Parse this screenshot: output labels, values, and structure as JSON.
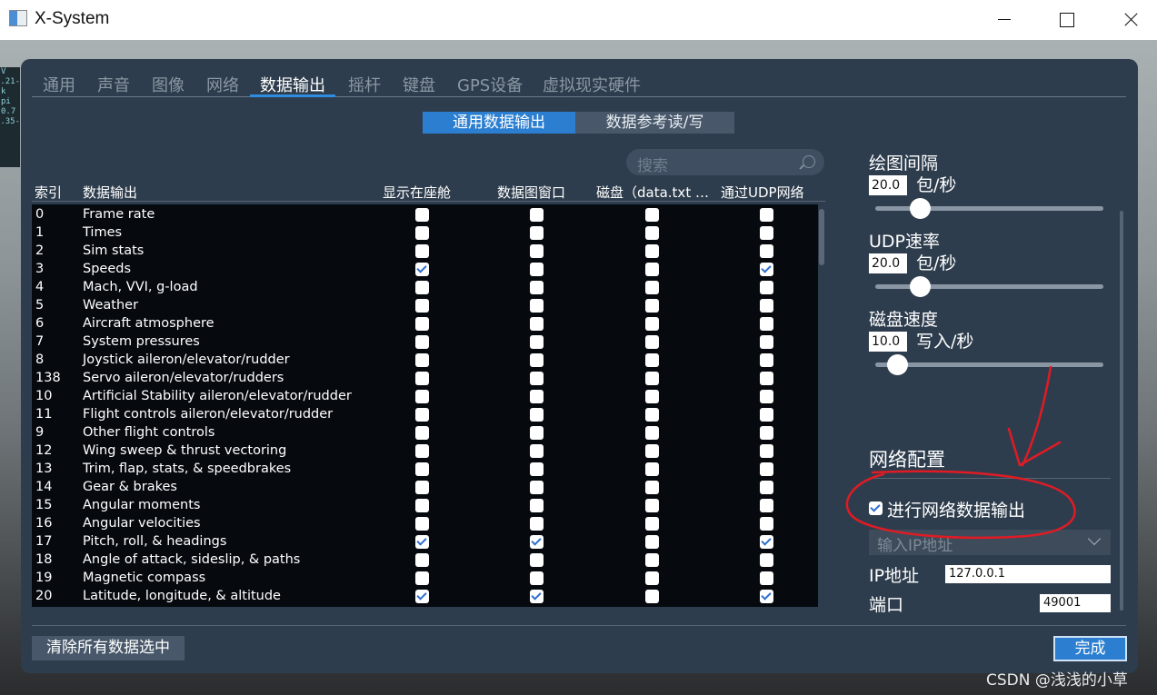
{
  "window": {
    "title": "X-System"
  },
  "hud": {
    "lines": [
      "V",
      "-21.",
      "k",
      "",
      "pi",
      "0.7",
      "",
      "-35."
    ]
  },
  "tabs": [
    {
      "label": "通用"
    },
    {
      "label": "声音"
    },
    {
      "label": "图像"
    },
    {
      "label": "网络"
    },
    {
      "label": "数据输出",
      "active": true
    },
    {
      "label": "摇杆"
    },
    {
      "label": "键盘"
    },
    {
      "label": "GPS设备"
    },
    {
      "label": "虚拟现实硬件"
    }
  ],
  "segments": {
    "general": "通用数据输出",
    "dataref": "数据参考读/写"
  },
  "search": {
    "placeholder": "搜索"
  },
  "columns": {
    "index": "索引",
    "output": "数据输出",
    "cockpit": "显示在座舱",
    "graph": "数据图窗口",
    "disk": "磁盘（data.txt …",
    "udp": "通过UDP网络"
  },
  "rows": [
    {
      "index": "0",
      "name": "Frame rate",
      "cockpit": false,
      "graph": false,
      "disk": false,
      "udp": false
    },
    {
      "index": "1",
      "name": "Times",
      "cockpit": false,
      "graph": false,
      "disk": false,
      "udp": false
    },
    {
      "index": "2",
      "name": "Sim stats",
      "cockpit": false,
      "graph": false,
      "disk": false,
      "udp": false
    },
    {
      "index": "3",
      "name": "Speeds",
      "cockpit": true,
      "graph": false,
      "disk": false,
      "udp": true
    },
    {
      "index": "4",
      "name": "Mach, VVI, g-load",
      "cockpit": false,
      "graph": false,
      "disk": false,
      "udp": false
    },
    {
      "index": "5",
      "name": "Weather",
      "cockpit": false,
      "graph": false,
      "disk": false,
      "udp": false
    },
    {
      "index": "6",
      "name": "Aircraft atmosphere",
      "cockpit": false,
      "graph": false,
      "disk": false,
      "udp": false
    },
    {
      "index": "7",
      "name": "System pressures",
      "cockpit": false,
      "graph": false,
      "disk": false,
      "udp": false
    },
    {
      "index": "8",
      "name": "Joystick aileron/elevator/rudder",
      "cockpit": false,
      "graph": false,
      "disk": false,
      "udp": false
    },
    {
      "index": "138",
      "name": "Servo aileron/elevator/rudders",
      "cockpit": false,
      "graph": false,
      "disk": false,
      "udp": false
    },
    {
      "index": "10",
      "name": "Artificial Stability aileron/elevator/rudder",
      "cockpit": false,
      "graph": false,
      "disk": false,
      "udp": false
    },
    {
      "index": "11",
      "name": "Flight controls aileron/elevator/rudder",
      "cockpit": false,
      "graph": false,
      "disk": false,
      "udp": false
    },
    {
      "index": "9",
      "name": "Other flight controls",
      "cockpit": false,
      "graph": false,
      "disk": false,
      "udp": false
    },
    {
      "index": "12",
      "name": "Wing sweep & thrust vectoring",
      "cockpit": false,
      "graph": false,
      "disk": false,
      "udp": false
    },
    {
      "index": "13",
      "name": "Trim, flap, stats, & speedbrakes",
      "cockpit": false,
      "graph": false,
      "disk": false,
      "udp": false
    },
    {
      "index": "14",
      "name": "Gear & brakes",
      "cockpit": false,
      "graph": false,
      "disk": false,
      "udp": false
    },
    {
      "index": "15",
      "name": "Angular moments",
      "cockpit": false,
      "graph": false,
      "disk": false,
      "udp": false
    },
    {
      "index": "16",
      "name": "Angular velocities",
      "cockpit": false,
      "graph": false,
      "disk": false,
      "udp": false
    },
    {
      "index": "17",
      "name": "Pitch, roll, & headings",
      "cockpit": true,
      "graph": true,
      "disk": false,
      "udp": true
    },
    {
      "index": "18",
      "name": "Angle of attack, sideslip, & paths",
      "cockpit": false,
      "graph": false,
      "disk": false,
      "udp": false
    },
    {
      "index": "19",
      "name": "Magnetic compass",
      "cockpit": false,
      "graph": false,
      "disk": false,
      "udp": false
    },
    {
      "index": "20",
      "name": "Latitude, longitude, & altitude",
      "cockpit": true,
      "graph": true,
      "disk": false,
      "udp": true
    }
  ],
  "rates": {
    "plot": {
      "label": "绘图间隔",
      "value": "20.0",
      "unit": "包/秒",
      "level": 0.2
    },
    "udp": {
      "label": "UDP速率",
      "value": "20.0",
      "unit": "包/秒",
      "level": 0.2
    },
    "disk": {
      "label": "磁盘速度",
      "value": "10.0",
      "unit": "写入/秒",
      "level": 0.1
    }
  },
  "network": {
    "title": "网络配置",
    "enable_label": "进行网络数据输出",
    "enabled": true,
    "ip_select_placeholder": "输入IP地址",
    "ip_label": "IP地址",
    "ip_value": "127.0.0.1",
    "port_label": "端口",
    "port_value": "49001"
  },
  "buttons": {
    "clear": "清除所有数据选中",
    "done": "完成"
  },
  "watermark": "CSDN @浅浅的小草",
  "colors": {
    "accent": "#2c7fd0",
    "dialog": "#2e3d4d",
    "annotation": "#e01b24"
  }
}
